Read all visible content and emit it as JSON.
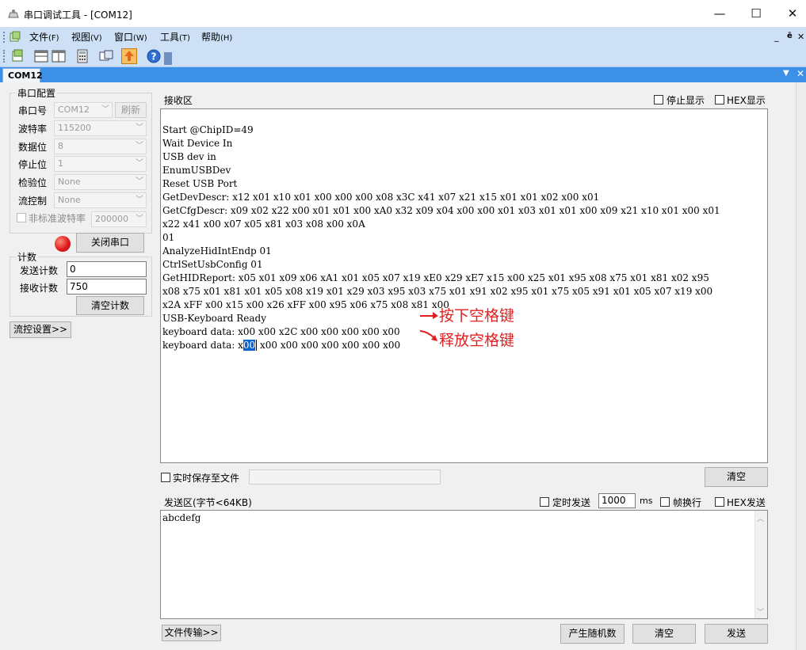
{
  "window": {
    "title": "串口调试工具 - [COM12]",
    "minimize": "—",
    "maximize": "☐",
    "close": "✕"
  },
  "menu": [
    {
      "label": "文件",
      "key": "(F)"
    },
    {
      "label": "视图",
      "key": "(V)"
    },
    {
      "label": "窗口",
      "key": "(W)"
    },
    {
      "label": "工具",
      "key": "(T)"
    },
    {
      "label": "帮助",
      "key": "(H)"
    }
  ],
  "menu_right": {
    "min": "_",
    "restore": "ē",
    "close": "✕"
  },
  "toolbar_icons": [
    "new-document-icon",
    "horizontal-split-icon",
    "vertical-split-icon",
    "calculator-icon",
    "window-icon",
    "upload-icon",
    "help-icon"
  ],
  "tab": {
    "label": "COM12"
  },
  "serial_config": {
    "group_label": "串口配置",
    "port_label": "串口号",
    "port_value": "COM12",
    "refresh_label": "刷新",
    "baud_label": "波特率",
    "baud_value": "115200",
    "databits_label": "数据位",
    "databits_value": "8",
    "stopbits_label": "停止位",
    "stopbits_value": "1",
    "parity_label": "检验位",
    "parity_value": "None",
    "flow_label": "流控制",
    "flow_value": "None",
    "nonstd_label": "非标准波特率",
    "nonstd_value": "200000",
    "close_port_label": "关闭串口",
    "indicator_color": "#e01b1b"
  },
  "counter": {
    "group_label": "计数",
    "send_label": "发送计数",
    "send_value": "0",
    "recv_label": "接收计数",
    "recv_value": "750",
    "clear_label": "清空计数"
  },
  "flow_settings_label": "流控设置>>",
  "receive": {
    "title": "接收区",
    "stop_display_label": "停止显示",
    "hex_display_label": "HEX显示",
    "lines": [
      "Start @ChipID=49",
      "Wait Device In",
      "USB dev in",
      "EnumUSBDev",
      "Reset USB Port",
      "GetDevDescr: x12 x01 x10 x01 x00 x00 x00 x08 x3C x41 x07 x21 x15 x01 x01 x02 x00 x01",
      "GetCfgDescr: x09 x02 x22 x00 x01 x01 x00 xA0 x32 x09 x04 x00 x00 x01 x03 x01 x01 x00 x09 x21 x10 x01 x00 x01",
      "x22 x41 x00 x07 x05 x81 x03 x08 x00 x0A",
      "01",
      "AnalyzeHidIntEndp 01",
      "CtrlSetUsbConfig 01",
      "GetHIDReport: x05 x01 x09 x06 xA1 x01 x05 x07 x19 xE0 x29 xE7 x15 x00 x25 x01 x95 x08 x75 x01 x81 x02 x95",
      "x08 x75 x01 x81 x01 x05 x08 x19 x01 x29 x03 x95 x03 x75 x01 x91 x02 x95 x01 x75 x05 x91 x01 x05 x07 x19 x00",
      "x2A xFF x00 x15 x00 x26 xFF x00 x95 x06 x75 x08 x81 x00",
      "USB-Keyboard Ready",
      "keyboard data: x00 x00 x2C x00 x00 x00 x00 x00"
    ],
    "last_line_prefix": "keyboard data: x",
    "last_line_selected": "00",
    "last_line_suffix": " x00 x00 x00 x00 x00 x00 x00",
    "annotation_press": "按下空格键",
    "annotation_release": "释放空格键",
    "annotation_color": "#e02020"
  },
  "save_file_label": "实时保存至文件",
  "clear_receive_label": "清空",
  "send": {
    "title": "发送区(字节<64KB)",
    "timed_send_label": "定时发送",
    "interval_value": "1000",
    "interval_unit": "ms",
    "newline_label": "帧换行",
    "hex_send_label": "HEX发送",
    "text": "abcdefg"
  },
  "file_transfer_label": "文件传输>>",
  "random_label": "产生随机数",
  "clear_send_label": "清空",
  "send_label": "发送"
}
